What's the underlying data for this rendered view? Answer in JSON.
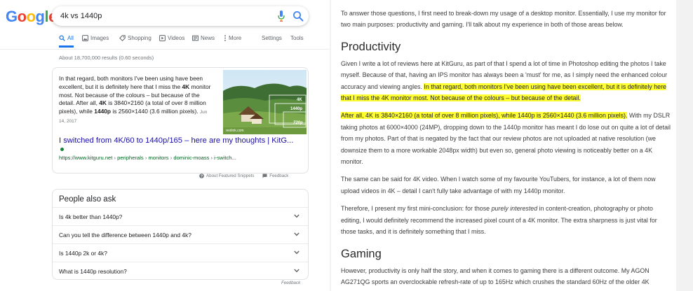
{
  "google": {
    "logo": [
      "G",
      "o",
      "o",
      "g",
      "l",
      "e"
    ],
    "logo_colors": [
      "#4285f4",
      "#ea4335",
      "#fbbc05",
      "#4285f4",
      "#34a853",
      "#ea4335"
    ],
    "search": {
      "query": "4k vs 1440p"
    },
    "tabs": [
      {
        "label": "All",
        "icon": "search-icon",
        "active": true
      },
      {
        "label": "Images",
        "icon": "image-icon"
      },
      {
        "label": "Shopping",
        "icon": "tag-icon"
      },
      {
        "label": "Videos",
        "icon": "video-icon"
      },
      {
        "label": "News",
        "icon": "news-icon"
      },
      {
        "label": "More",
        "icon": "more-vert-icon"
      },
      {
        "label": "Settings"
      },
      {
        "label": "Tools"
      }
    ],
    "result_stats": "About 18,700,000 results (0.60 seconds)",
    "featured_snippet": {
      "text_before_bold1": "In that regard, both monitors I've been using have been excellent, but it is definitely here that I miss the ",
      "bold1": "4K",
      "text_after_bold1": " monitor most. Not because of the colours – but because of the detail. After all, ",
      "bold2": "4K",
      "text_mid": " is 3840×2160 (a total of over 8 million pixels), while ",
      "bold3": "1440p",
      "text_end": " is 2560×1440 (3.6 million pixels).",
      "date": "Jun 14, 2017",
      "image_labels": {
        "watermark": "reolink.com",
        "res1": "4K",
        "res2": "1440p",
        "res3": "720p"
      },
      "title": "I switched from 4K/60 to 1440p/165 – here are my thoughts | KitG...",
      "url_parts": [
        "https://www.kitguru.net",
        "peripherals",
        "monitors",
        "dominic-moass",
        "i-switch..."
      ],
      "url_separator": " › ",
      "footer_about": "About Featured Snippets",
      "footer_feedback": "Feedback"
    },
    "people_also_ask": {
      "heading": "People also ask",
      "questions": [
        "Is 4k better than 1440p?",
        "Can you tell the difference between 1440p and 4k?",
        "Is 1440p 2k or 4k?",
        "What is 1440p resolution?"
      ],
      "feedback": "Feedback"
    }
  },
  "article": {
    "intro": "To answer those questions, I first need to break-down my usage of a desktop monitor. Essentially, I use my monitor for two main purposes: productivity and gaming. I'll talk about my experience in both of those areas below.",
    "heading_productivity": "Productivity",
    "p1_plain": "Given I write a lot of reviews here at KitGuru, as part of that I spend a lot of time in Photoshop editing the photos I take myself. Because of that, having an IPS monitor has always been a 'must' for me, as I simply need the enhanced colour accuracy and viewing angles. ",
    "p1_highlight": "In that regard, both monitors I've been using have been excellent, but it is definitely here that I miss the 4K monitor most. Not because of the colours – but because of the detail.",
    "p2_highlight": "After all, 4K is 3840×2160 (a total of over 8 million pixels), while 1440p is 2560×1440 (3.6 million pixels).",
    "p2_plain": " With my DSLR taking photos at 6000×4000 (24MP), dropping down to the 1440p monitor has meant I do lose out on quite a lot of detail from my photos. Part of that is negated by the fact that our review photos are not uploaded at native resolution (we downsize them to a more workable 2048px width) but even so, general photo viewing is noticeably better on a 4K monitor.",
    "p3": "The same can be said for 4K video. When I watch some of my favourite YouTubers, for instance, a lot of them now upload videos in 4K – detail I can't fully take advantage of with my 1440p monitor.",
    "p4_before": "Therefore, I present my first mini-conclusion: for those ",
    "p4_em": "purely interested",
    "p4_after": " in content-creation, photography or photo editing, I would definitely recommend the increased pixel count of a 4K monitor. The extra sharpness is just vital for those tasks, and it is definitely something that I miss.",
    "heading_gaming": "Gaming",
    "p5": "However, productivity is only half the story, and when it comes to gaming there is a different outcome. My AGON AG271QG sports an overclockable refresh-rate of up to 165Hz which crushes the standard 60Hz of the older 4K"
  },
  "colors": {
    "link": "#1a0dab",
    "url_green": "#006621",
    "accent": "#1a73e8",
    "highlight": "#ffff33"
  }
}
